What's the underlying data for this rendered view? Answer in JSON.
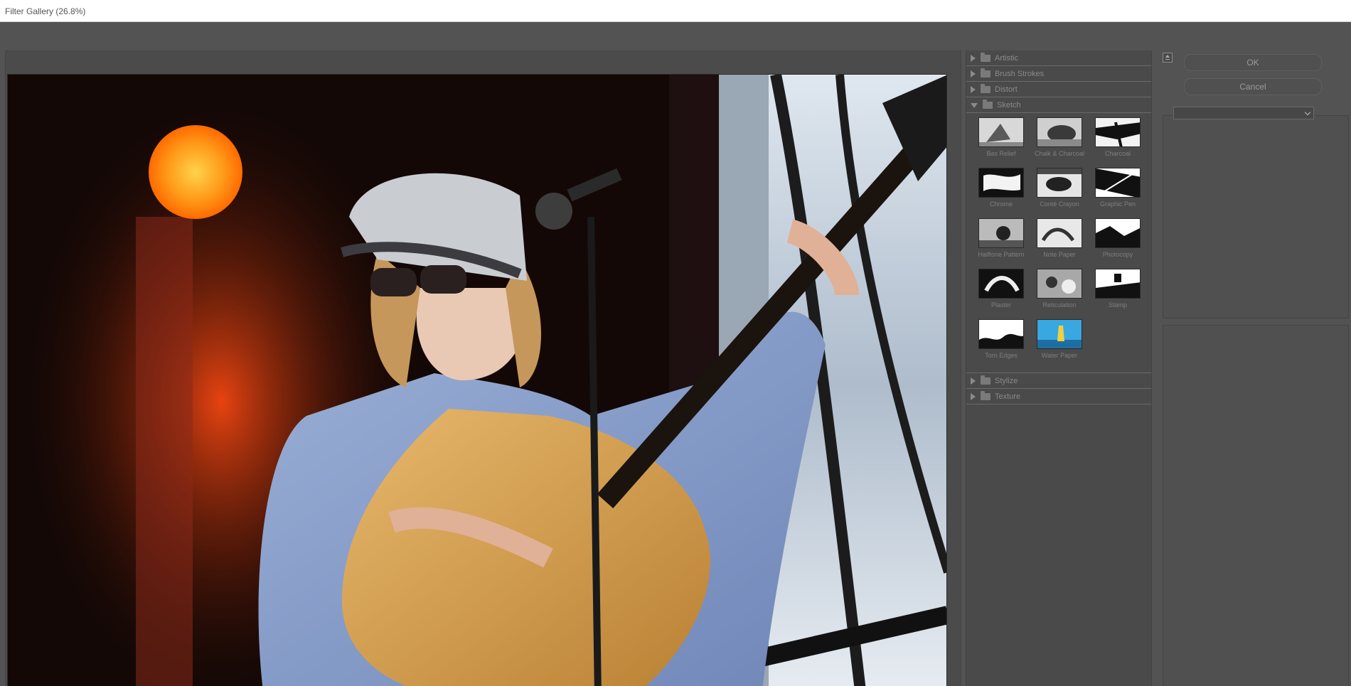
{
  "window": {
    "title": "Filter Gallery (26.8%)"
  },
  "filters": {
    "categories_top": [
      {
        "label": "Artistic",
        "open": false
      },
      {
        "label": "Brush Strokes",
        "open": false
      },
      {
        "label": "Distort",
        "open": false
      },
      {
        "label": "Sketch",
        "open": true
      }
    ],
    "sketch_items": [
      {
        "label": "Bas Relief",
        "icon": "bas-relief-thumb"
      },
      {
        "label": "Chalk & Charcoal",
        "icon": "chalk-charcoal-thumb"
      },
      {
        "label": "Charcoal",
        "icon": "charcoal-thumb"
      },
      {
        "label": "Chrome",
        "icon": "chrome-thumb"
      },
      {
        "label": "Conté Crayon",
        "icon": "conte-crayon-thumb"
      },
      {
        "label": "Graphic Pen",
        "icon": "graphic-pen-thumb"
      },
      {
        "label": "Halftone Pattern",
        "icon": "halftone-pattern-thumb"
      },
      {
        "label": "Note Paper",
        "icon": "note-paper-thumb"
      },
      {
        "label": "Photocopy",
        "icon": "photocopy-thumb"
      },
      {
        "label": "Plaster",
        "icon": "plaster-thumb"
      },
      {
        "label": "Reticulation",
        "icon": "reticulation-thumb"
      },
      {
        "label": "Stamp",
        "icon": "stamp-thumb"
      },
      {
        "label": "Torn Edges",
        "icon": "torn-edges-thumb"
      },
      {
        "label": "Water Paper",
        "icon": "water-paper-thumb"
      }
    ],
    "categories_bottom": [
      {
        "label": "Stylize",
        "open": false
      },
      {
        "label": "Texture",
        "open": false
      }
    ]
  },
  "panel": {
    "ok_label": "OK",
    "cancel_label": "Cancel",
    "filter_select_value": ""
  },
  "colors": {
    "dialog_bg": "#535353",
    "panel_bg": "#4a4a4a",
    "text_muted": "#8a8a8a"
  },
  "icons": {
    "collapse": "collapse-up-icon",
    "folder": "folder-icon",
    "disclosure": "triangle-arrow-icon"
  }
}
